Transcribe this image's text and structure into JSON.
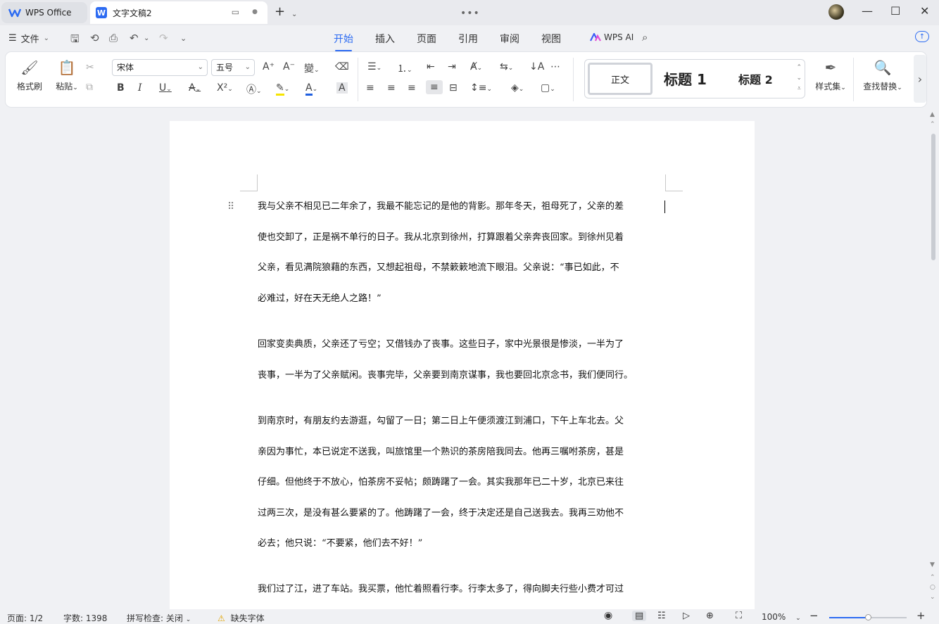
{
  "titlebar": {
    "home_tab": "WPS Office",
    "doc_tab": "文字文稿2",
    "doc_icon": "W",
    "new_tab_icon": "plus-icon",
    "more_icon": "more-dots-icon"
  },
  "menu": {
    "file_label": "文件",
    "tabs": [
      "开始",
      "插入",
      "页面",
      "引用",
      "审阅",
      "视图"
    ],
    "active_tab": "开始",
    "ai_label": "WPS AI"
  },
  "ribbon": {
    "format_painter": "格式刷",
    "paste": "粘贴",
    "font_name": "宋体",
    "font_size": "五号",
    "style_normal": "正文",
    "style_h1": "标题 1",
    "style_h2": "标题 2",
    "style_set": "样式集",
    "find_replace": "查找替换",
    "font_color": "#1f5fe0",
    "highlight_color": "#f6e400",
    "accent_color": "#2c6bf2"
  },
  "document": {
    "paragraphs": [
      [
        "我与父亲不相见已二年余了，我最不能忘记的是他的背影。那年冬天，祖母死了，父亲的差",
        "使也交卸了，正是祸不单行的日子。我从北京到徐州，打算跟着父亲奔丧回家。到徐州见着",
        "父亲，看见满院狼藉的东西，又想起祖母，不禁簌簌地流下眼泪。父亲说：“事已如此，不",
        "必难过，好在天无绝人之路！”"
      ],
      [
        "回家变卖典质，父亲还了亏空；又借钱办了丧事。这些日子，家中光景很是惨淡，一半为了",
        "丧事，一半为了父亲赋闲。丧事完毕，父亲要到南京谋事，我也要回北京念书，我们便同行。"
      ],
      [
        "到南京时，有朋友约去游逛，勾留了一日；第二日上午便须渡江到浦口，下午上车北去。父",
        "亲因为事忙，本已说定不送我，叫旅馆里一个熟识的茶房陪我同去。他再三嘱咐茶房，甚是",
        "仔细。但他终于不放心，怕茶房不妥帖；颇踌躇了一会。其实我那年已二十岁，北京已来往",
        "过两三次，是没有甚么要紧的了。他踌躇了一会，终于决定还是自己送我去。我再三劝他不",
        "必去；他只说：“不要紧，他们去不好！”"
      ],
      [
        "我们过了江，进了车站。我买票，他忙着照看行李。行李太多了，得向脚夫行些小费才可过"
      ]
    ]
  },
  "status": {
    "page": "页面: 1/2",
    "word_count": "字数: 1398",
    "spell_check": "拼写检查: 关闭",
    "missing_font": "缺失字体",
    "zoom": "100%",
    "zoom_fraction": 0.5
  }
}
